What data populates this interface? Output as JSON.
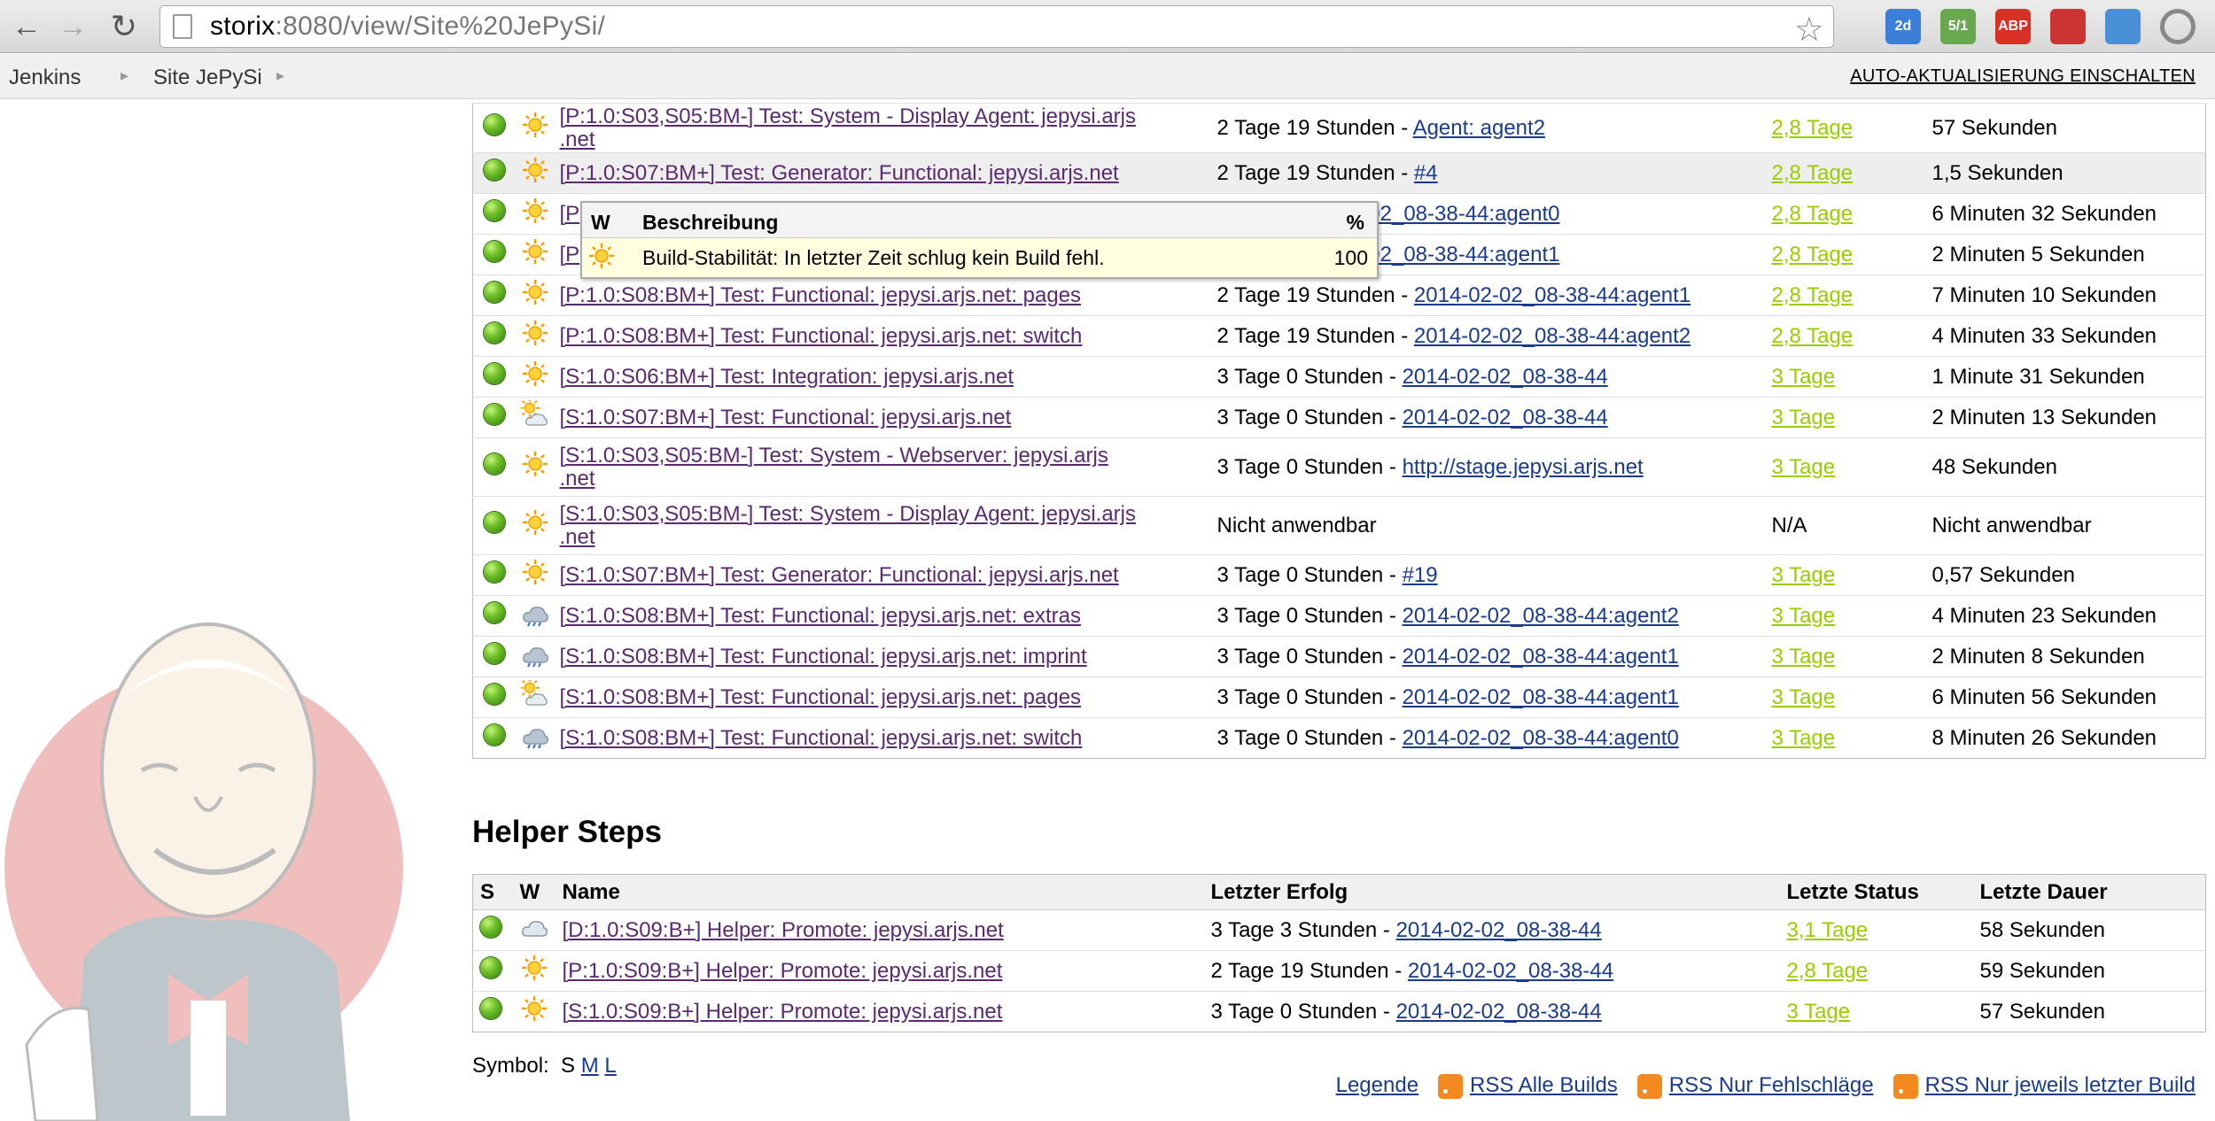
{
  "browser": {
    "url_host": "storix",
    "url_rest": ":8080/view/Site%20JePySi/",
    "extensions": [
      {
        "icon": "calendar-icon",
        "badge": "2d",
        "color": "#3b7fd9"
      },
      {
        "icon": "mail-count-icon",
        "badge": "5/1",
        "color": "#6aa84f"
      },
      {
        "icon": "abp-icon",
        "badge": "ABP",
        "color": "#d93025"
      },
      {
        "icon": "bookmark-ext-icon",
        "badge": "",
        "color": "#cc3333"
      },
      {
        "icon": "window-icon",
        "badge": "",
        "color": "#4a90d9"
      },
      {
        "icon": "loading-icon",
        "badge": "",
        "color": "#888888"
      }
    ]
  },
  "breadcrumbs": [
    "Jenkins",
    "Site JePySi"
  ],
  "auto_refresh": "AUTO-AKTUALISIERUNG EINSCHALTEN",
  "tooltip": {
    "col_w": "W",
    "col_desc": "Beschreibung",
    "col_pct": "%",
    "desc": "Build-Stabilität: In letzter Zeit schlug kein Build fehl.",
    "pct": "100"
  },
  "jobs": [
    {
      "weather": "sunny",
      "name_lines": [
        "[P:1.0:S03,S05:BM-] Test: System - Display Agent: jepysi.arjs",
        ".net"
      ],
      "success_prefix": "2 Tage 19 Stunden - ",
      "success_link": "Agent: agent2",
      "status": "2,8 Tage",
      "duration": "57 Sekunden"
    },
    {
      "weather": "sunny",
      "name_lines": [
        "[P:1.0:S07:BM+] Test: Generator: Functional: jepysi.arjs.net"
      ],
      "success_prefix": "2 Tage 19 Stunden - ",
      "success_link": "#4",
      "status": "2,8 Tage",
      "duration": "1,5 Sekunden",
      "highlight": true
    },
    {
      "weather": "sunny",
      "name_lines": [
        "[P"
      ],
      "success_prefix": "nden - ",
      "success_link": "2014-02-02_08-38-44:agent0",
      "status": "2,8 Tage",
      "duration": "6 Minuten 32 Sekunden"
    },
    {
      "weather": "sunny",
      "name_lines": [
        "[P"
      ],
      "success_prefix": "nden - ",
      "success_link": "2014-02-02_08-38-44:agent1",
      "status": "2,8 Tage",
      "duration": "2 Minuten 5 Sekunden"
    },
    {
      "weather": "sunny",
      "name_lines": [
        "[P:1.0:S08:BM+] Test: Functional: jepysi.arjs.net: pages"
      ],
      "success_prefix": "2 Tage 19 Stunden - ",
      "success_link": "2014-02-02_08-38-44:agent1",
      "status": "2,8 Tage",
      "duration": "7 Minuten 10 Sekunden"
    },
    {
      "weather": "sunny",
      "name_lines": [
        "[P:1.0:S08:BM+] Test: Functional: jepysi.arjs.net: switch"
      ],
      "success_prefix": "2 Tage 19 Stunden - ",
      "success_link": "2014-02-02_08-38-44:agent2",
      "status": "2,8 Tage",
      "duration": "4 Minuten 33 Sekunden"
    },
    {
      "weather": "sunny",
      "name_lines": [
        "[S:1.0:S06:BM+] Test: Integration: jepysi.arjs.net"
      ],
      "success_prefix": "3 Tage 0 Stunden - ",
      "success_link": "2014-02-02_08-38-44",
      "status": "3 Tage",
      "duration": "1 Minute 31 Sekunden"
    },
    {
      "weather": "partly-cloudy",
      "name_lines": [
        "[S:1.0:S07:BM+] Test: Functional: jepysi.arjs.net"
      ],
      "success_prefix": "3 Tage 0 Stunden - ",
      "success_link": "2014-02-02_08-38-44",
      "status": "3 Tage",
      "duration": "2 Minuten 13 Sekunden"
    },
    {
      "weather": "sunny",
      "name_lines": [
        "[S:1.0:S03,S05:BM-] Test: System - Webserver: jepysi.arjs",
        ".net"
      ],
      "success_prefix": "3 Tage 0 Stunden - ",
      "success_link": "http://stage.jepysi.arjs.net",
      "status": "3 Tage",
      "duration": "48 Sekunden"
    },
    {
      "weather": "sunny",
      "name_lines": [
        "[S:1.0:S03,S05:BM-] Test: System - Display Agent: jepysi.arjs",
        ".net"
      ],
      "success_prefix": "Nicht anwendbar",
      "success_link": "",
      "status_plain": "N/A",
      "duration": "Nicht anwendbar"
    },
    {
      "weather": "sunny",
      "name_lines": [
        "[S:1.0:S07:BM+] Test: Generator: Functional: jepysi.arjs.net"
      ],
      "success_prefix": "3 Tage 0 Stunden - ",
      "success_link": "#19",
      "status": "3 Tage",
      "duration": "0,57 Sekunden"
    },
    {
      "weather": "rainy",
      "name_lines": [
        "[S:1.0:S08:BM+] Test: Functional: jepysi.arjs.net: extras"
      ],
      "success_prefix": "3 Tage 0 Stunden - ",
      "success_link": "2014-02-02_08-38-44:agent2",
      "status": "3 Tage",
      "duration": "4 Minuten 23 Sekunden"
    },
    {
      "weather": "rainy",
      "name_lines": [
        "[S:1.0:S08:BM+] Test: Functional: jepysi.arjs.net: imprint"
      ],
      "success_prefix": "3 Tage 0 Stunden - ",
      "success_link": "2014-02-02_08-38-44:agent1",
      "status": "3 Tage",
      "duration": "2 Minuten 8 Sekunden"
    },
    {
      "weather": "partly-cloudy",
      "name_lines": [
        "[S:1.0:S08:BM+] Test: Functional: jepysi.arjs.net: pages"
      ],
      "success_prefix": "3 Tage 0 Stunden - ",
      "success_link": "2014-02-02_08-38-44:agent1",
      "status": "3 Tage",
      "duration": "6 Minuten 56 Sekunden"
    },
    {
      "weather": "rainy",
      "name_lines": [
        "[S:1.0:S08:BM+] Test: Functional: jepysi.arjs.net: switch"
      ],
      "success_prefix": "3 Tage 0 Stunden - ",
      "success_link": "2014-02-02_08-38-44:agent0",
      "status": "3 Tage",
      "duration": "8 Minuten 26 Sekunden"
    }
  ],
  "helper": {
    "title": "Helper Steps",
    "headers": [
      "S",
      "W",
      "Name",
      "Letzter Erfolg",
      "Letzte Status",
      "Letzte Dauer"
    ],
    "rows": [
      {
        "weather": "cloudy",
        "name": "[D:1.0:S09:B+] Helper: Promote: jepysi.arjs.net",
        "success_prefix": "3 Tage 3 Stunden - ",
        "success_link": "2014-02-02_08-38-44",
        "status": "3,1 Tage",
        "duration": "58 Sekunden"
      },
      {
        "weather": "sunny",
        "name": "[P:1.0:S09:B+] Helper: Promote: jepysi.arjs.net",
        "success_prefix": "2 Tage 19 Stunden - ",
        "success_link": "2014-02-02_08-38-44",
        "status": "2,8 Tage",
        "duration": "59 Sekunden"
      },
      {
        "weather": "sunny",
        "name": "[S:1.0:S09:B+] Helper: Promote: jepysi.arjs.net",
        "success_prefix": "3 Tage 0 Stunden - ",
        "success_link": "2014-02-02_08-38-44",
        "status": "3 Tage",
        "duration": "57 Sekunden"
      }
    ]
  },
  "symbol": {
    "label": "Symbol:",
    "current": "S",
    "options": [
      "M",
      "L"
    ]
  },
  "footer_links": [
    "Legende",
    "RSS Alle Builds",
    "RSS Nur Fehlschläge",
    "RSS Nur jeweils letzter Build"
  ]
}
